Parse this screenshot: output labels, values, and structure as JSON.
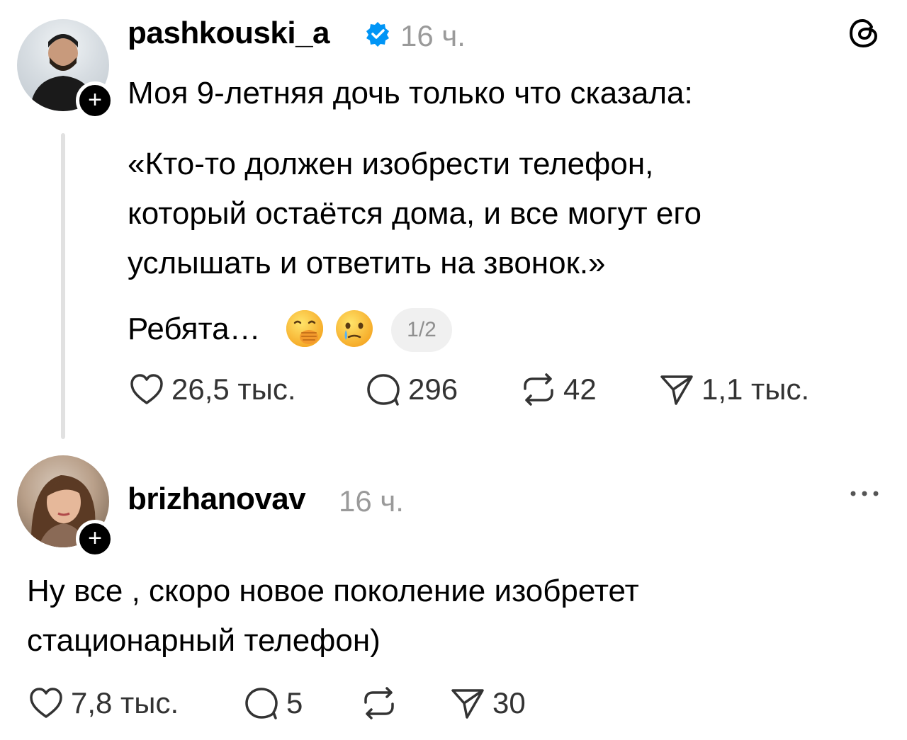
{
  "post": {
    "username": "pashkouski_a",
    "time": "16 ч.",
    "line1": "Моя 9-летняя дочь только что сказала:",
    "quote_lines": [
      "«Кто-то должен изобрести телефон,",
      "который остаётся дома, и все могут его",
      "услышать и ответить на звонок.»"
    ],
    "closing": "Ребята…",
    "page_counter": "1/2",
    "likes": "26,5 тыс.",
    "replies": "296",
    "reposts": "42",
    "shares": "1,1 тыс."
  },
  "reply": {
    "username": "brizhanovav",
    "time": "16 ч.",
    "text_lines": [
      "Ну все , скоро новое поколение изобретет",
      "стационарный телефон)"
    ],
    "likes": "7,8 тыс.",
    "replies": "5",
    "shares": "30"
  },
  "colors": {
    "verified": "#0095f6",
    "muted": "#9a9a9a",
    "thread_line": "#e1e1e1"
  },
  "icons": [
    "threads-logo",
    "verified-badge",
    "heart-icon",
    "comment-icon",
    "repost-icon",
    "share-icon",
    "more-icon"
  ]
}
